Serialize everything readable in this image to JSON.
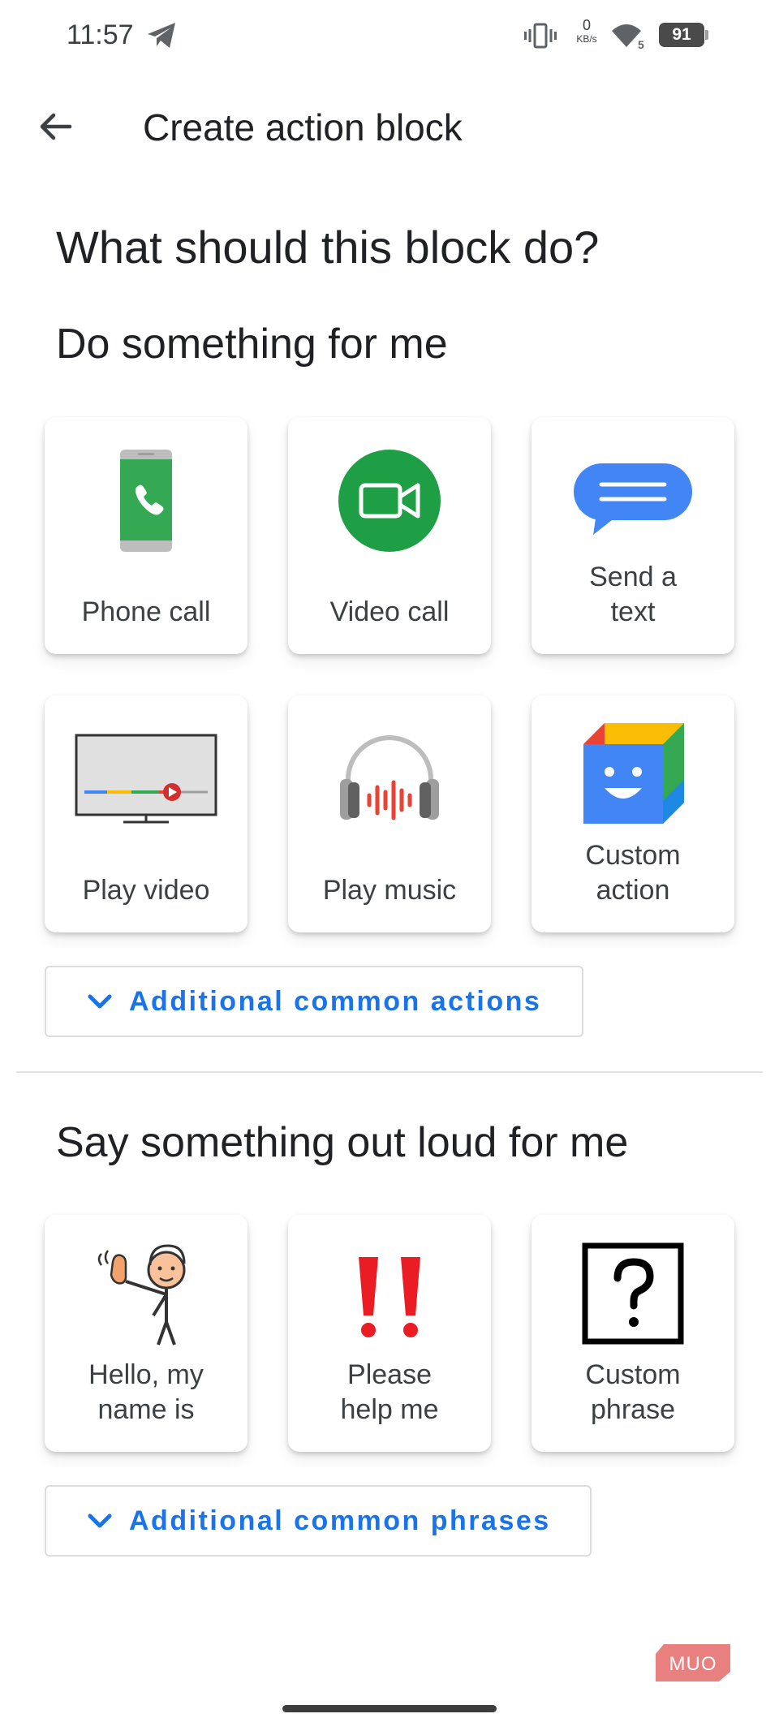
{
  "status_bar": {
    "time": "11:57",
    "net_speed_value": "0",
    "net_speed_unit": "KB/s",
    "wifi_badge": "5",
    "battery": "91"
  },
  "app_bar": {
    "back_icon": "arrow-back-icon",
    "title": "Create action block"
  },
  "heading": "What should this block do?",
  "do_section": {
    "title": "Do something for me",
    "tiles": [
      {
        "label": "Phone call",
        "icon": "phone-call-icon"
      },
      {
        "label": "Video call",
        "icon": "video-call-icon"
      },
      {
        "label": "Send a text",
        "icon": "message-bubble-icon"
      },
      {
        "label": "Play video",
        "icon": "tv-play-icon"
      },
      {
        "label": "Play music",
        "icon": "headphones-icon"
      },
      {
        "label": "Custom action",
        "icon": "smiling-cube-icon"
      }
    ],
    "more_button": "Additional common actions"
  },
  "say_section": {
    "title": "Say something out loud for me",
    "tiles": [
      {
        "label": "Hello, my name is",
        "icon": "waving-person-icon"
      },
      {
        "label": "Please help me",
        "icon": "double-exclamation-icon"
      },
      {
        "label": "Custom phrase",
        "icon": "question-box-icon"
      }
    ],
    "more_button": "Additional common phrases"
  },
  "watermark": "MUO",
  "colors": {
    "accent_blue": "#1a73e8",
    "phone_green": "#34a853",
    "video_green": "#1e9e45",
    "message_blue": "#4285f4",
    "exclaim_red": "#ea1c24"
  }
}
